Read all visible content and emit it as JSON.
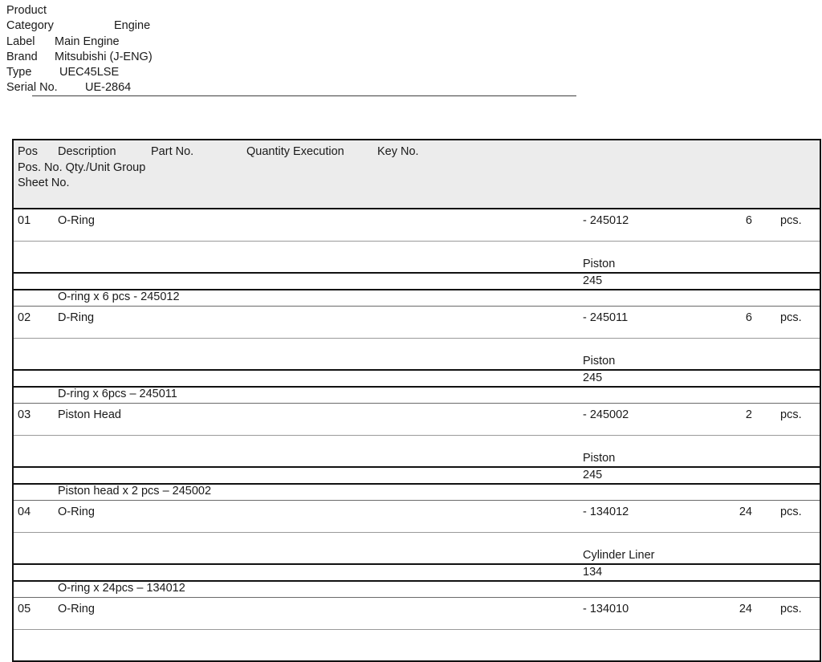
{
  "product": {
    "title": "Product",
    "fields": [
      {
        "label": "Category",
        "value": "Engine"
      },
      {
        "label": "Label",
        "value": "Main Engine"
      },
      {
        "label": "Brand",
        "value": "Mitsubishi (J-ENG)"
      },
      {
        "label": "Type",
        "value": "UEC45LSE"
      },
      {
        "label": "Serial No.",
        "value": "UE-2864"
      }
    ]
  },
  "table": {
    "header": {
      "pos": "Pos",
      "description": "Description",
      "part_no": "Part No.",
      "quantity_execution": "Quantity Execution",
      "key_no": "Key No.",
      "line2": "Pos. No. Qty./Unit Group",
      "line3": "Sheet No."
    },
    "unit_label": "pcs.",
    "rows": [
      {
        "pos": "01",
        "description": "O-Ring",
        "part_no": "- 245012",
        "quantity": "6",
        "unit": "pcs.",
        "group": "Piston",
        "sheet_no": "245",
        "note": "O-ring x 6 pcs - 245012"
      },
      {
        "pos": "02",
        "description": "D-Ring",
        "part_no": "- 245011",
        "quantity": "6",
        "unit": "pcs.",
        "group": "Piston",
        "sheet_no": "245",
        "note": "D-ring x 6pcs – 245011"
      },
      {
        "pos": "03",
        "description": "Piston Head",
        "part_no": "- 245002",
        "quantity": "2",
        "unit": "pcs.",
        "group": "Piston",
        "sheet_no": "245",
        "note": "Piston head x 2 pcs – 245002"
      },
      {
        "pos": "04",
        "description": "O-Ring",
        "part_no": "- 134012",
        "quantity": "24",
        "unit": "pcs.",
        "group": "Cylinder Liner",
        "sheet_no": "134",
        "note": "O-ring x 24pcs – 134012"
      },
      {
        "pos": "05",
        "description": "O-Ring",
        "part_no": "- 134010",
        "quantity": "24",
        "unit": "pcs.",
        "group": "",
        "sheet_no": "",
        "note": ""
      }
    ]
  }
}
